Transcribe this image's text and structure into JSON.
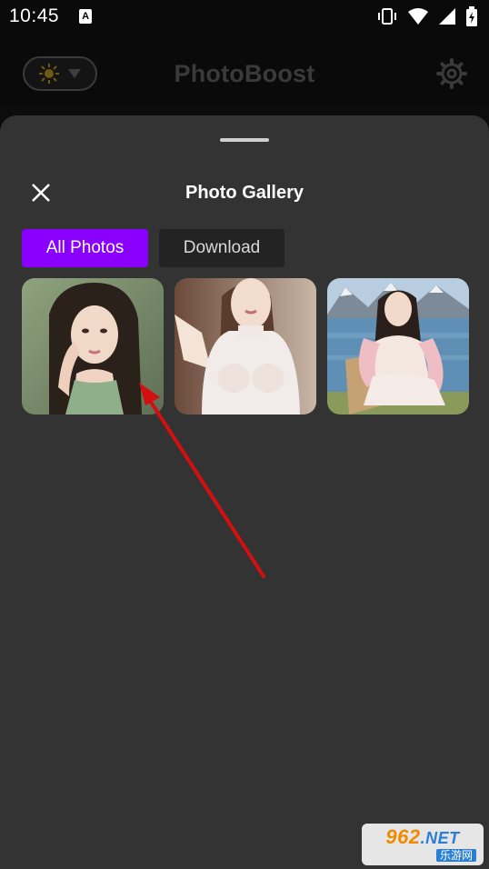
{
  "status_bar": {
    "time": "10:45",
    "notification_icon_letter": "A",
    "icons": [
      "vibrate-icon",
      "wifi-icon",
      "signal-icon",
      "battery-charging-icon"
    ]
  },
  "app_header": {
    "title": "PhotoBoost",
    "mode_icon": "sun-icon",
    "mode_dropdown_icon": "triangle-down-icon",
    "settings_icon": "gear-icon"
  },
  "sheet": {
    "title": "Photo Gallery",
    "close_icon": "close-icon",
    "tabs": [
      {
        "label": "All Photos",
        "active": true
      },
      {
        "label": "Download",
        "active": false
      }
    ],
    "photos": [
      {
        "name": "photo-1"
      },
      {
        "name": "photo-2"
      },
      {
        "name": "photo-3"
      }
    ]
  },
  "watermark": {
    "main": "962",
    "suffix": ".NET",
    "sub": "乐游网"
  },
  "colors": {
    "accent": "#8a00ff",
    "sheet_bg": "#333333",
    "tab_inactive_bg": "#232323",
    "arrow": "#e01010"
  }
}
